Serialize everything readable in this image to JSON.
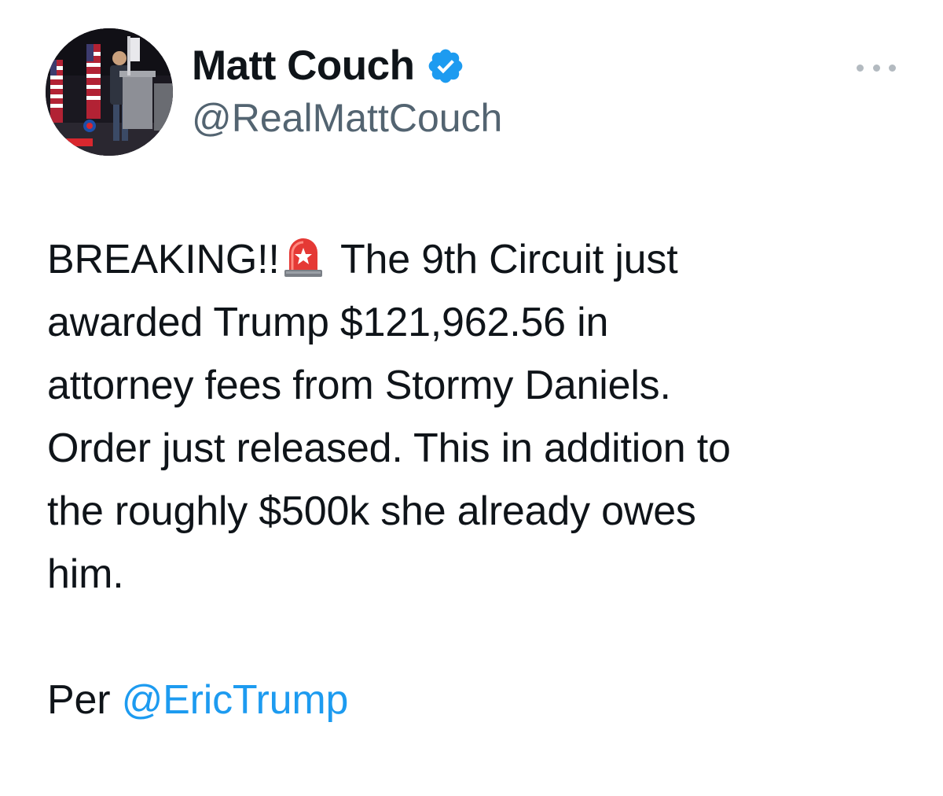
{
  "author": {
    "display_name": "Matt Couch",
    "handle": "@RealMattCouch",
    "verified": true,
    "verified_color": "#1d9bf0"
  },
  "tweet": {
    "line1_pre": "BREAKING!!",
    "line1_post": " The 9th Circuit just",
    "line2": "awarded Trump $121,962.56 in",
    "line3": "attorney fees from Stormy Daniels.",
    "line4": "Order just released. This in addition to",
    "line5": "the roughly $500k she already owes",
    "line6": "him.",
    "per_prefix": "Per ",
    "mention": "@EricTrump",
    "mention_color": "#1d9bf0"
  },
  "icons": {
    "avatar": "profile-photo",
    "verified": "verified-badge-icon",
    "siren": "police-siren-emoji",
    "more": "more-options-icon"
  }
}
